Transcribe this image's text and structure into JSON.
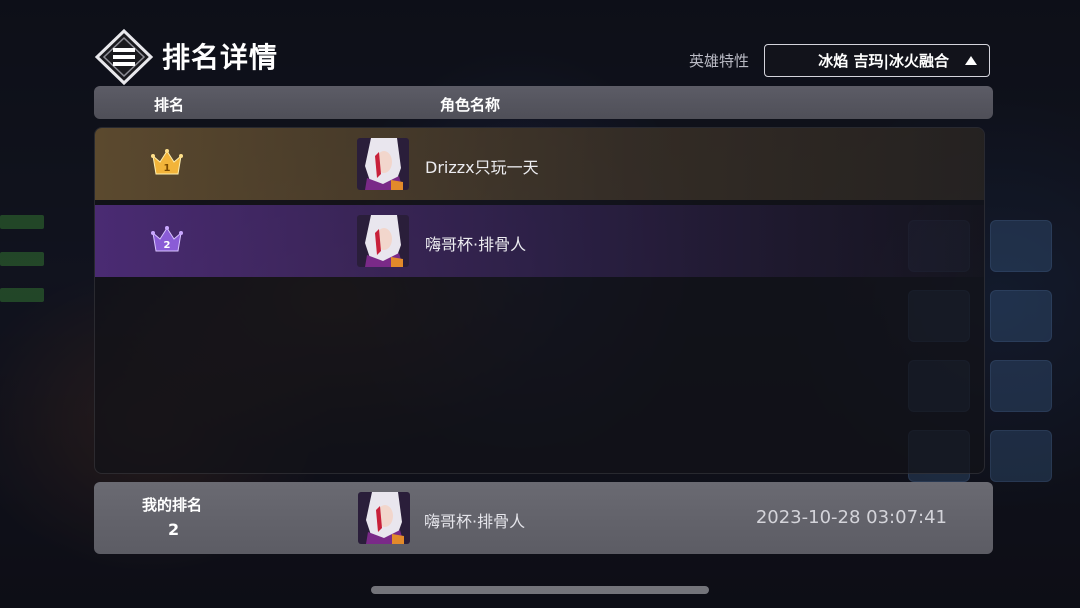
{
  "header": {
    "title": "排名详情",
    "logo_icon": "rank-emblem-icon"
  },
  "filter": {
    "label": "英雄特性",
    "selected": "冰焰 吉玛|冰火融合",
    "arrow_icon": "triangle-up-icon"
  },
  "table": {
    "columns": [
      "排名",
      "角色名称"
    ],
    "rows": [
      {
        "rank": 1,
        "rank_icon": "gold-crown-icon",
        "name": "Drizzx只玩一天",
        "avatar": "hero-avatar"
      },
      {
        "rank": 2,
        "rank_icon": "purple-crown-icon",
        "name": "嗨哥杯·排骨人",
        "avatar": "hero-avatar"
      }
    ]
  },
  "my_rank": {
    "label": "我的排名",
    "value": "2",
    "name": "嗨哥杯·排骨人",
    "timestamp": "2023-10-28 03:07:41"
  },
  "colors": {
    "gold_row": "#7a5f37",
    "purple_row": "#5a328c",
    "header_bar": "#55555e"
  }
}
